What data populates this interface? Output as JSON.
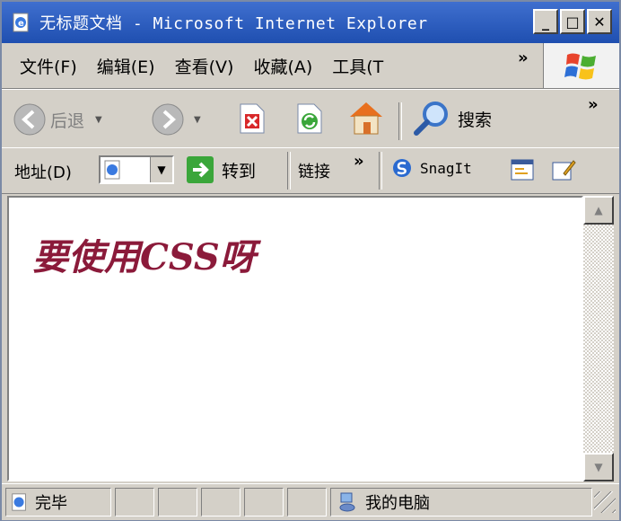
{
  "titlebar": {
    "title": "无标题文档 - Microsoft Internet Explorer",
    "icon": "ie-page-icon",
    "buttons": {
      "minimize": "_",
      "maximize": "□",
      "close": "✕"
    }
  },
  "menubar": {
    "items": [
      "文件(F)",
      "编辑(E)",
      "查看(V)",
      "收藏(A)",
      "工具(T"
    ],
    "chevron": "»"
  },
  "toolbar": {
    "back_label": "后退",
    "search_label": "搜索",
    "chevron": "»"
  },
  "addressbar": {
    "label": "地址(D)",
    "value": "",
    "go_label": "转到",
    "links_label": "链接",
    "links_chevron": "»",
    "snagit_label": "SnagIt"
  },
  "content": {
    "heading": "要使用CSS呀"
  },
  "statusbar": {
    "status": "完毕",
    "zone": "我的电脑"
  },
  "colors": {
    "title_bar": "#2a5bc0",
    "heading": "#8b1a3a",
    "chrome": "#d4d0c8"
  }
}
